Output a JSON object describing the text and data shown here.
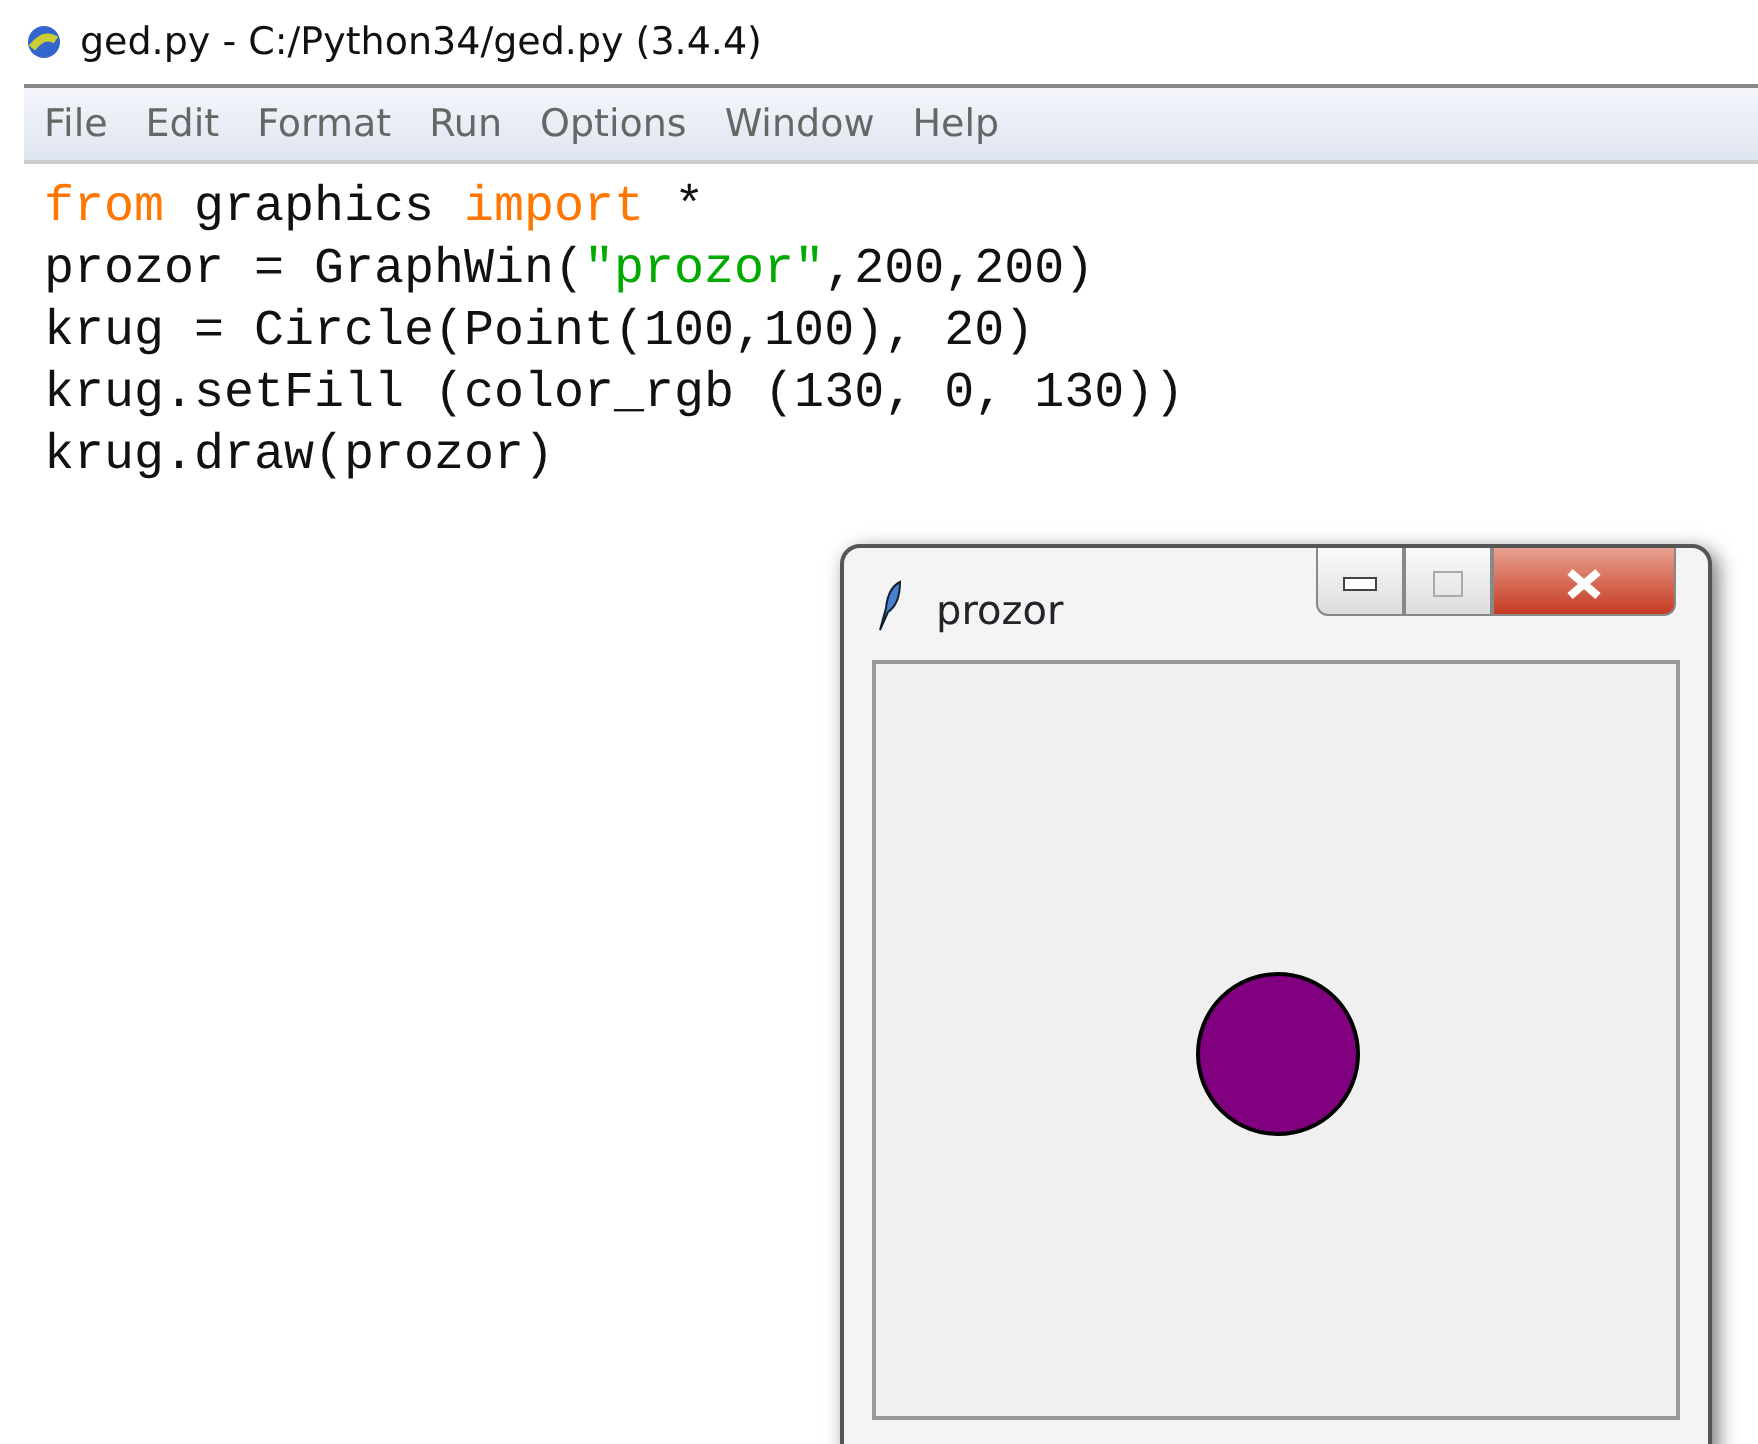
{
  "window": {
    "title": "ged.py - C:/Python34/ged.py (3.4.4)"
  },
  "menu": [
    "File",
    "Edit",
    "Format",
    "Run",
    "Options",
    "Window",
    "Help"
  ],
  "code_lines": [
    [
      {
        "kind": "keyword",
        "text": "from"
      },
      {
        "kind": "plain",
        "text": " graphics "
      },
      {
        "kind": "keyword",
        "text": "import"
      },
      {
        "kind": "plain",
        "text": " *"
      }
    ],
    [
      {
        "kind": "plain",
        "text": "prozor = GraphWin("
      },
      {
        "kind": "string",
        "text": "\"prozor\""
      },
      {
        "kind": "plain",
        "text": ",200,200)"
      }
    ],
    [
      {
        "kind": "plain",
        "text": "krug = Circle(Point(100,100), 20)"
      }
    ],
    [
      {
        "kind": "plain",
        "text": "krug.setFill (color_rgb (130, 0, 130))"
      }
    ],
    [
      {
        "kind": "plain",
        "text": "krug.draw(prozor)"
      }
    ]
  ],
  "graph_window": {
    "title": "prozor"
  }
}
